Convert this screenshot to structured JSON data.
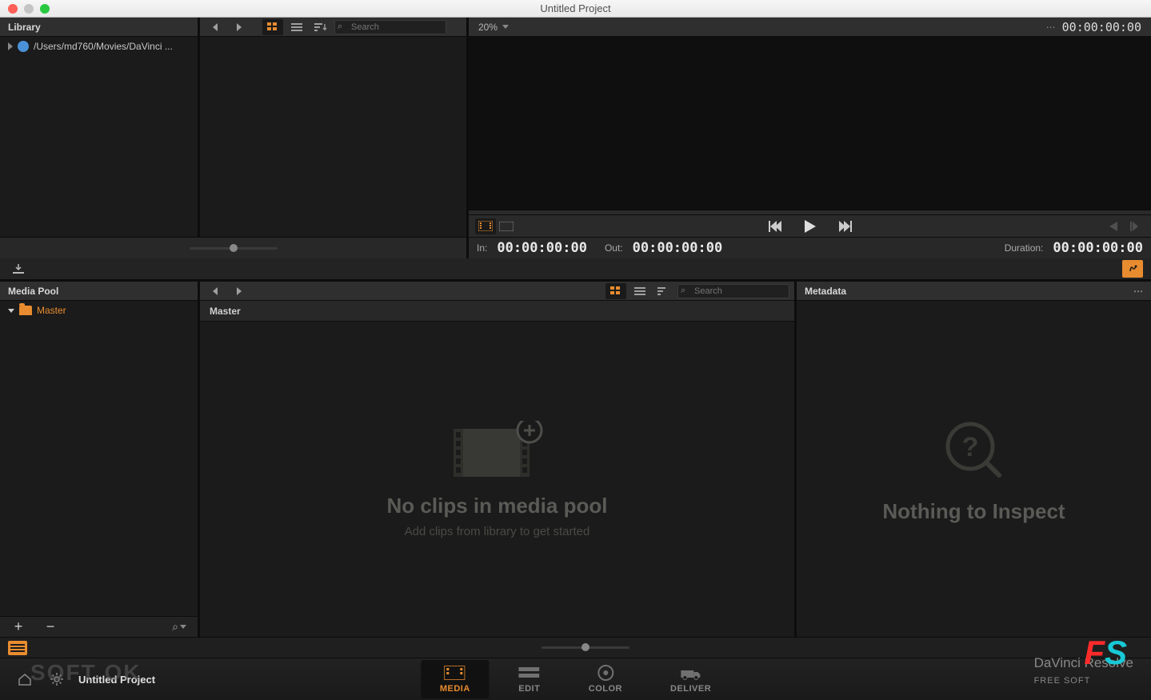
{
  "window": {
    "title": "Untitled Project"
  },
  "library": {
    "header": "Library",
    "path": "/Users/md760/Movies/DaVinci ...",
    "search_placeholder": "Search"
  },
  "viewer": {
    "zoom": "20%",
    "timecode": "00:00:00:00",
    "in_label": "In:",
    "in_value": "00:00:00:00",
    "out_label": "Out:",
    "out_value": "00:00:00:00",
    "duration_label": "Duration:",
    "duration_value": "00:00:00:00"
  },
  "mediapool": {
    "header": "Media Pool",
    "master": "Master",
    "bin_title": "Master",
    "search_placeholder": "Search",
    "empty_title": "No clips in media pool",
    "empty_sub": "Add clips from library to get started"
  },
  "metadata": {
    "header": "Metadata",
    "empty_title": "Nothing to Inspect"
  },
  "pagebar": {
    "project": "Untitled Project",
    "tabs": [
      {
        "label": "MEDIA"
      },
      {
        "label": "EDIT"
      },
      {
        "label": "COLOR"
      },
      {
        "label": "DELIVER"
      }
    ]
  },
  "watermark": {
    "softok": "SOFT OK",
    "brand": "DaVinci Resolve",
    "sub": "FREE SOFT"
  }
}
